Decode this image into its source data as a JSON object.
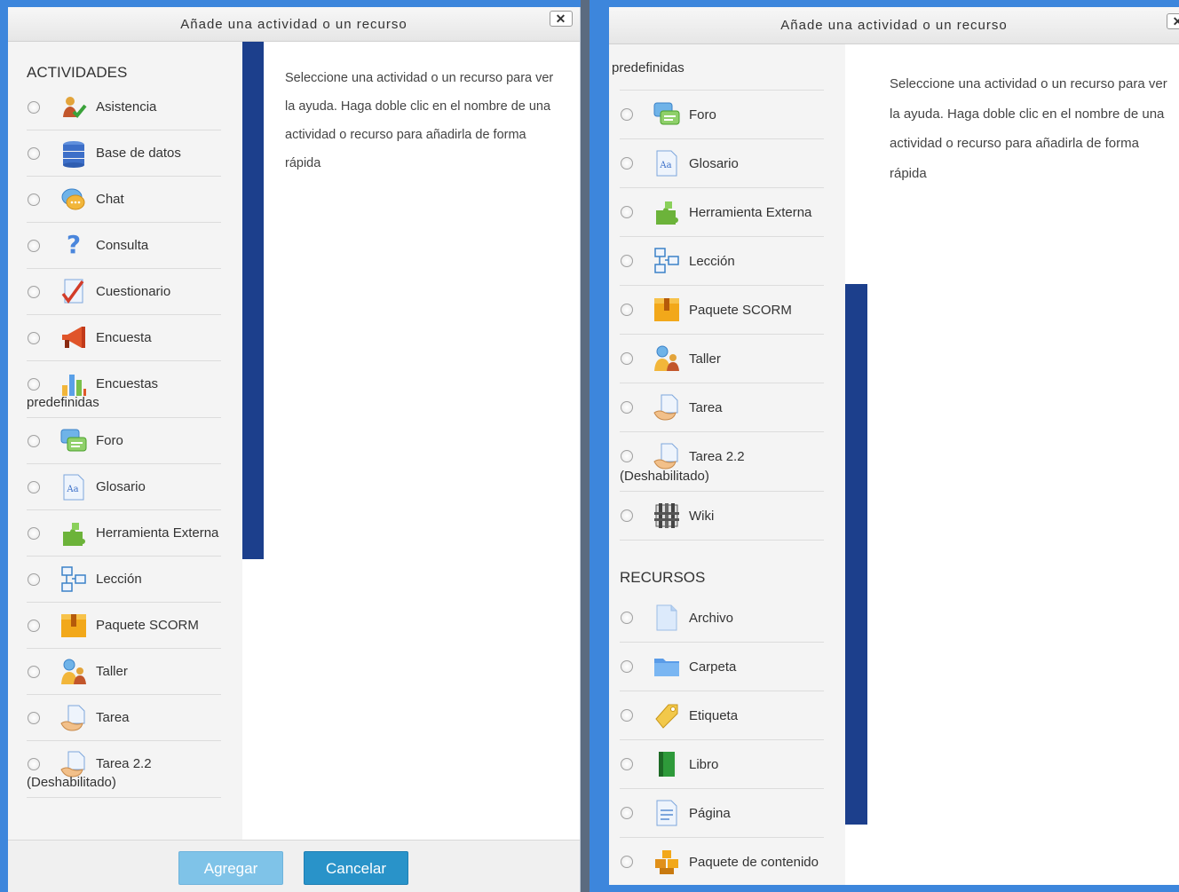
{
  "dialog_left": {
    "title": "Añade una actividad o un recurso",
    "close": "✕",
    "section_activities": "ACTIVIDADES",
    "items": [
      {
        "label": "Asistencia",
        "icon": "attendance-icon"
      },
      {
        "label": "Base de datos",
        "icon": "database-icon"
      },
      {
        "label": "Chat",
        "icon": "chat-icon"
      },
      {
        "label": "Consulta",
        "icon": "question-icon"
      },
      {
        "label": "Cuestionario",
        "icon": "quiz-icon"
      },
      {
        "label": "Encuesta",
        "icon": "megaphone-icon"
      },
      {
        "label": "Encuestas",
        "label2": "predefinidas",
        "icon": "bar-chart-icon"
      },
      {
        "label": "Foro",
        "icon": "forum-icon"
      },
      {
        "label": "Glosario",
        "icon": "glossary-icon"
      },
      {
        "label": "Herramienta Externa",
        "icon": "puzzle-icon"
      },
      {
        "label": "Lección",
        "icon": "lesson-icon"
      },
      {
        "label": "Paquete SCORM",
        "icon": "scorm-box-icon"
      },
      {
        "label": "Taller",
        "icon": "workshop-icon"
      },
      {
        "label": "Tarea",
        "icon": "assignment-icon"
      },
      {
        "label": "Tarea 2.2",
        "label2": "(Deshabilitado)",
        "icon": "assignment-icon"
      }
    ],
    "help_text": "Seleccione una actividad o un recurso para ver la ayuda. Haga doble clic en el nombre de una actividad o recurso para añadirla de forma rápida",
    "add_button": "Agregar",
    "cancel_button": "Cancelar"
  },
  "dialog_right": {
    "title": "Añade una actividad o un recurso",
    "close": "✕",
    "top_cut_label": "predefinidas",
    "items": [
      {
        "label": "Foro",
        "icon": "forum-icon"
      },
      {
        "label": "Glosario",
        "icon": "glossary-icon"
      },
      {
        "label": "Herramienta Externa",
        "icon": "puzzle-icon"
      },
      {
        "label": "Lección",
        "icon": "lesson-icon"
      },
      {
        "label": "Paquete SCORM",
        "icon": "scorm-box-icon"
      },
      {
        "label": "Taller",
        "icon": "workshop-icon"
      },
      {
        "label": "Tarea",
        "icon": "assignment-icon"
      },
      {
        "label": "Tarea 2.2",
        "label2": "(Deshabilitado)",
        "icon": "assignment-icon"
      },
      {
        "label": "Wiki",
        "icon": "wiki-icon"
      }
    ],
    "section_resources": "RECURSOS",
    "resources": [
      {
        "label": "Archivo",
        "icon": "file-icon"
      },
      {
        "label": "Carpeta",
        "icon": "folder-icon"
      },
      {
        "label": "Etiqueta",
        "icon": "label-tag-icon"
      },
      {
        "label": "Libro",
        "icon": "book-icon"
      },
      {
        "label": "Página",
        "icon": "page-icon"
      },
      {
        "label": "Paquete de contenido",
        "icon": "content-package-icon"
      }
    ],
    "help_text": "Seleccione una actividad o un recurso para ver la ayuda. Haga doble clic en el nombre de una actividad o recurso para añadirla de forma rápida"
  }
}
